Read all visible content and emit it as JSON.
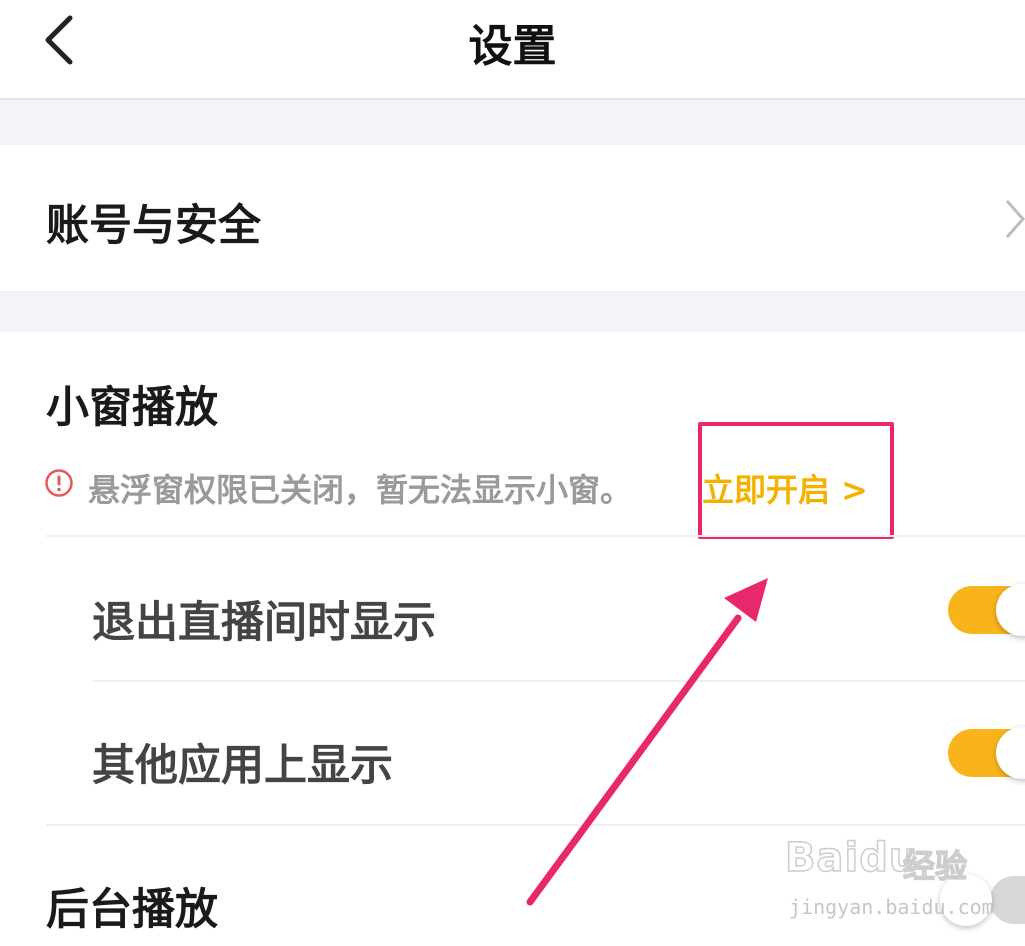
{
  "header": {
    "title": "设置",
    "back_icon": "chevron-left-icon"
  },
  "account": {
    "label": "账号与安全",
    "chevron_icon": "chevron-right-icon"
  },
  "mini_window": {
    "title": "小窗播放",
    "warning": {
      "icon": "alert-circle-icon",
      "text": "悬浮窗权限已关闭，暂无法显示小窗。",
      "link_label": "立即开启 >"
    },
    "options": [
      {
        "label": "退出直播间时显示",
        "enabled": true
      },
      {
        "label": "其他应用上显示",
        "enabled": true
      }
    ]
  },
  "background_play": {
    "label": "后台播放",
    "enabled": false
  },
  "annotation": {
    "color": "#e8286d"
  },
  "watermark": {
    "brand": "Baidu",
    "cn": "经验",
    "url": "jingyan.baidu.com"
  },
  "colors": {
    "accent": "#f9b41c",
    "warning": "#e25a5a",
    "link": "#f5b100"
  }
}
